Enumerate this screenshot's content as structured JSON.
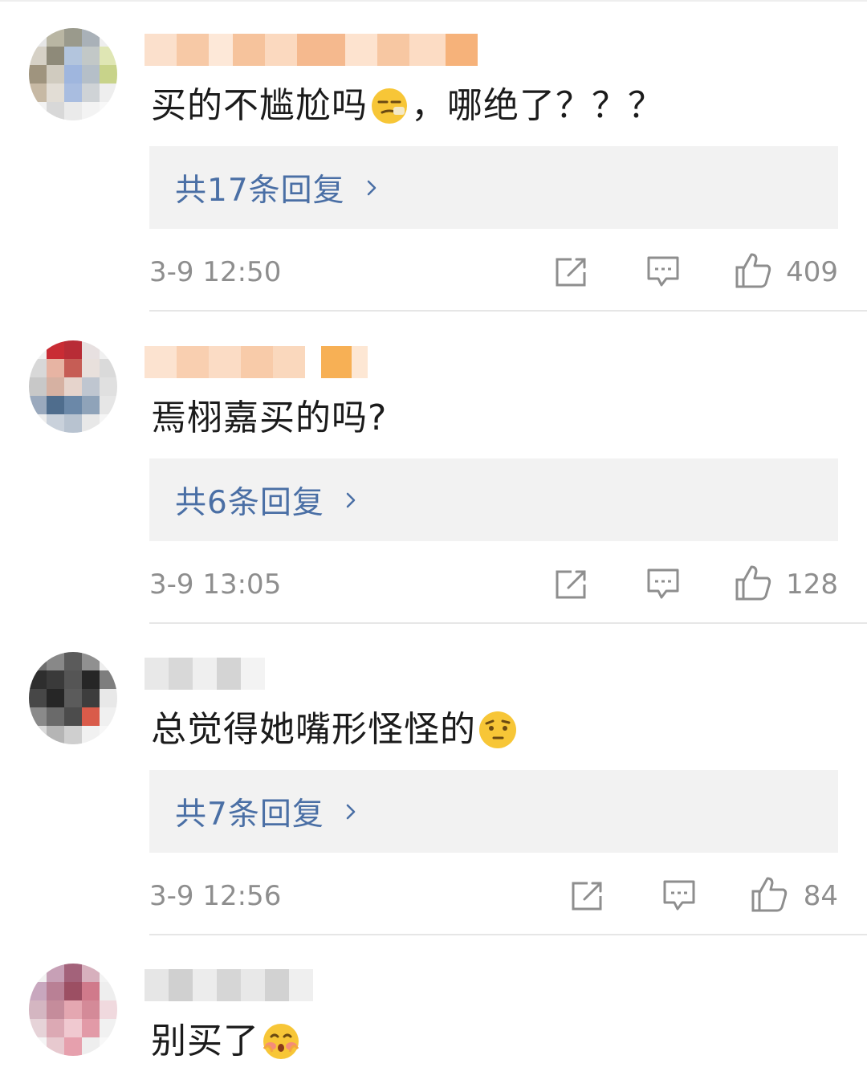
{
  "comments": [
    {
      "text": "买的不尴尬吗",
      "text_after": "，哪绝了？？？",
      "emoji": "smirk-emoji",
      "replies_label": "共17条回复",
      "time": "3-9 12:50",
      "likes": "409"
    },
    {
      "text": "焉栩嘉买的吗?",
      "text_after": "",
      "emoji": "",
      "replies_label": "共6条回复",
      "time": "3-9 13:05",
      "likes": "128"
    },
    {
      "text": "总觉得她嘴形怪怪的",
      "text_after": "",
      "emoji": "raised-eyebrow-emoji",
      "replies_label": "共7条回复",
      "time": "3-9 12:56",
      "likes": "84"
    },
    {
      "text": "别买了",
      "text_after": "",
      "emoji": "shy-blush-emoji",
      "replies_label": "",
      "time": "",
      "likes": ""
    }
  ],
  "colors": {
    "reply_link": "#4a6fa5",
    "reply_box": "#f2f2f2",
    "meta_gray": "#8e8e8e"
  }
}
